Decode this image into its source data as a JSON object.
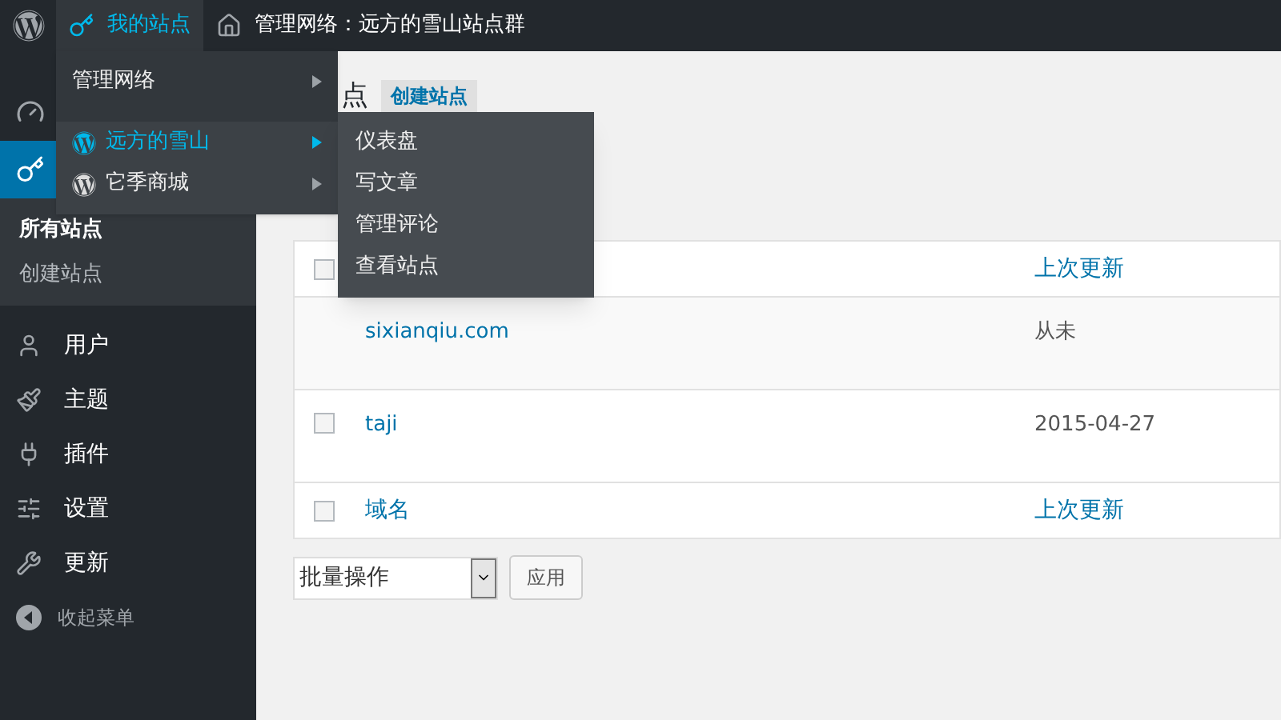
{
  "top_bar": {
    "my_sites": {
      "label": "我的站点",
      "selected": true
    },
    "network": {
      "label": "管理网络：远方的雪山站点群"
    }
  },
  "sites_menu": {
    "items": [
      {
        "label": "管理网络",
        "kind": "plain",
        "selected": false
      },
      {
        "label": "远方的雪山",
        "kind": "site",
        "selected": true
      },
      {
        "label": "它季商城",
        "kind": "site",
        "selected": false
      }
    ],
    "submenu": [
      "仪表盘",
      "写文章",
      "管理评论",
      "查看站点"
    ]
  },
  "sidebar": {
    "icon_items": [
      {
        "selected": false
      },
      {
        "selected": true
      }
    ],
    "submenu": [
      {
        "label": "所有站点",
        "selected": true
      },
      {
        "label": "创建站点",
        "selected": false
      }
    ],
    "items": [
      {
        "label": "用户"
      },
      {
        "label": "主题"
      },
      {
        "label": "插件"
      },
      {
        "label": "设置"
      },
      {
        "label": "更新"
      }
    ],
    "collapse": "收起菜单"
  },
  "page": {
    "title": "点",
    "add_button": "创建站点"
  },
  "table": {
    "header": {
      "checked": false,
      "columns": [
        "上次更新"
      ]
    },
    "rows": [
      {
        "domain": "sixianqiu.com",
        "updated": "从未"
      },
      {
        "checked": false,
        "domain": "taji",
        "updated": "2015-04-27"
      }
    ],
    "footer": {
      "checked": false,
      "columns": [
        "域名",
        "上次更新"
      ]
    }
  },
  "bulk": {
    "select": "批量操作",
    "apply": "应用"
  }
}
